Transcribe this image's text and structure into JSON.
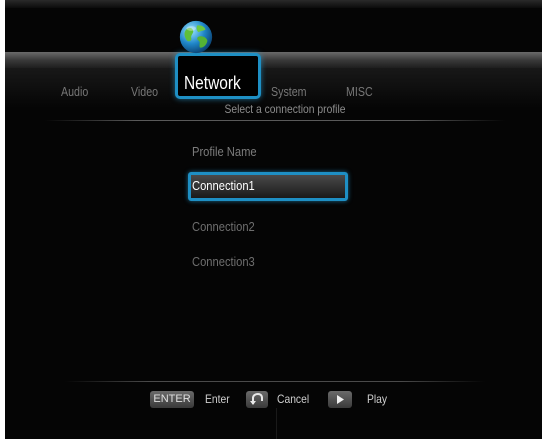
{
  "tabs": {
    "audio": "Audio",
    "video": "Video",
    "network": "Network",
    "system": "System",
    "misc": "MISC",
    "active": "Network",
    "active_icon": "globe-icon"
  },
  "colors": {
    "highlight": "#1e8fc4",
    "background": "#050505",
    "text_active": "#ffffff",
    "text_inactive": "#777777"
  },
  "main": {
    "subtitle": "Select a connection profile",
    "list_header": "Profile Name",
    "profiles": [
      "Connection1",
      "Connection2",
      "Connection3"
    ],
    "selected": "Connection1"
  },
  "footer": {
    "enter_key": "ENTER",
    "enter_label": "Enter",
    "cancel_icon": "back-arrow-icon",
    "cancel_label": "Cancel",
    "play_icon": "play-icon",
    "play_label": "Play"
  }
}
